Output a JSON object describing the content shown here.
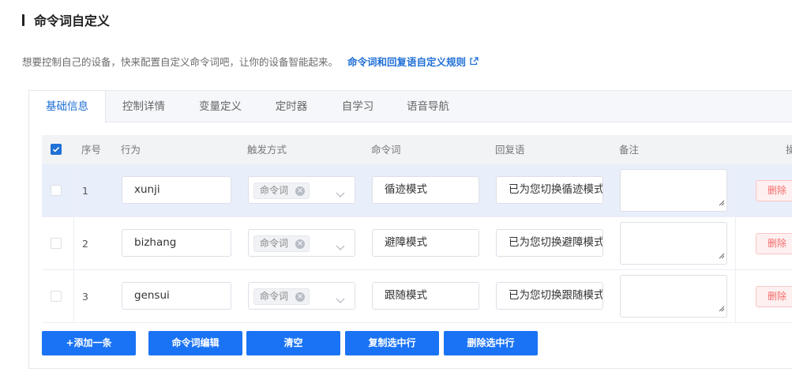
{
  "header": {
    "title": "命令词自定义",
    "description": "想要控制自己的设备，快来配置自定义命令词吧，让你的设备智能起来。",
    "rules_link": "命令词和回复语自定义规则"
  },
  "tabs": [
    "基础信息",
    "控制详情",
    "变量定义",
    "定时器",
    "自学习",
    "语音导航"
  ],
  "active_tab": "基础信息",
  "table": {
    "columns": [
      "序号",
      "行为",
      "触发方式",
      "命令词",
      "回复语",
      "备注",
      "操"
    ],
    "rows": [
      {
        "index": "1",
        "action": "xunji",
        "trigger_tag": "命令词",
        "command": "循迹模式",
        "reply": "已为您切换循迹模式",
        "note": "",
        "delete_label": "删除",
        "selected": true
      },
      {
        "index": "2",
        "action": "bizhang",
        "trigger_tag": "命令词",
        "command": "避障模式",
        "reply": "已为您切换避障模式",
        "note": "",
        "delete_label": "删除",
        "selected": false
      },
      {
        "index": "3",
        "action": "gensui",
        "trigger_tag": "命令词",
        "command": "跟随模式",
        "reply": "已为您切换跟随模式",
        "note": "",
        "delete_label": "删除",
        "selected": false
      }
    ]
  },
  "buttons": [
    "+添加一条",
    "命令词编辑",
    "清空",
    "复制选中行",
    "删除选中行"
  ],
  "colors": {
    "primary": "#1a73f5",
    "link": "#1f6fd6",
    "danger": "#f56c6c",
    "selected_row": "#e9eefb"
  }
}
